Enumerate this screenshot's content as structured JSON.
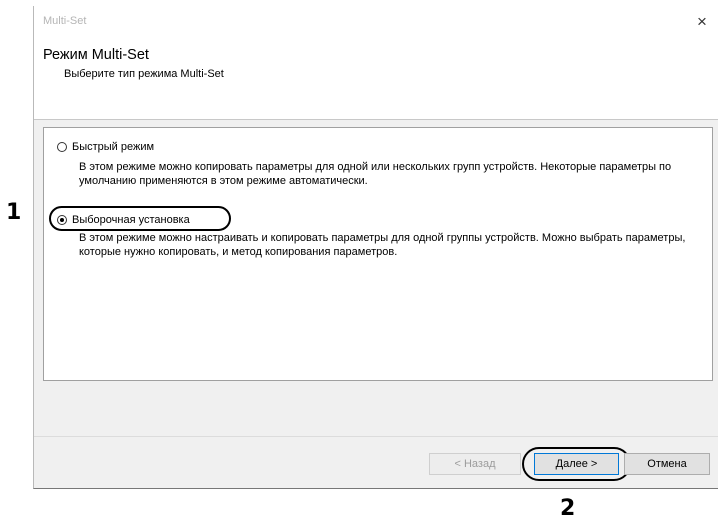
{
  "window": {
    "title": "Multi-Set",
    "close_glyph": "×"
  },
  "header": {
    "title": "Режим Multi-Set",
    "subtitle": "Выберите тип режима Multi-Set"
  },
  "options": [
    {
      "label": "Быстрый режим",
      "selected": false,
      "description": "В этом режиме можно копировать параметры для одной или нескольких групп устройств. Некоторые параметры по умолчанию применяются в этом режиме автоматически."
    },
    {
      "label": "Выборочная установка",
      "selected": true,
      "description": "В этом режиме можно настраивать и копировать параметры для одной группы устройств. Можно выбрать параметры, которые нужно копировать, и метод копирования параметров."
    }
  ],
  "buttons": {
    "back": "< Назад",
    "next": "Далее >",
    "cancel": "Отмена"
  },
  "callouts": {
    "one": "1",
    "two": "2"
  }
}
